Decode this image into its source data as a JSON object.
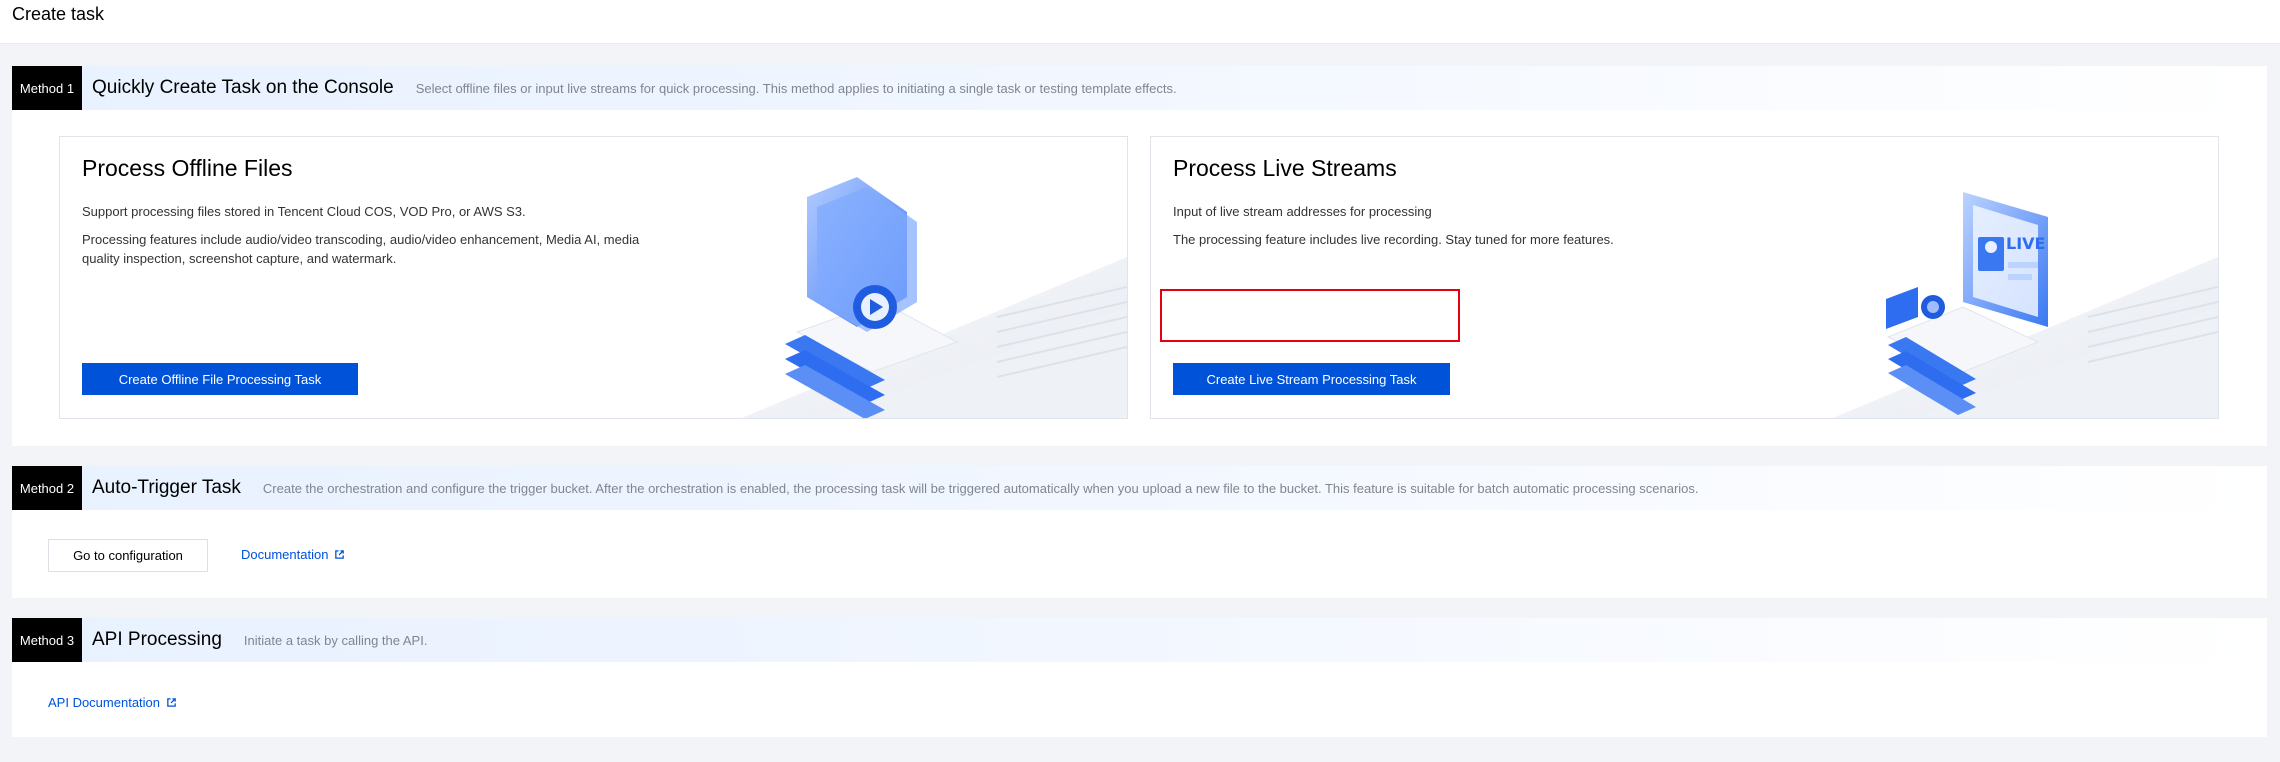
{
  "page": {
    "title": "Create task"
  },
  "method1": {
    "tag": "Method 1",
    "title": "Quickly Create Task on the Console",
    "description": "Select offline files or input live streams for quick processing. This method applies to initiating a single task or testing template effects.",
    "offline_card": {
      "title": "Process Offline Files",
      "line1": "Support processing files stored in Tencent Cloud COS, VOD Pro, or AWS S3.",
      "line2": "Processing features include audio/video transcoding, audio/video enhancement, Media AI, media quality inspection, screenshot capture, and watermark.",
      "button": "Create Offline File Processing Task",
      "illustration": "folder-play-icon"
    },
    "live_card": {
      "title": "Process Live Streams",
      "line1": "Input of live stream addresses for processing",
      "line2": "The processing feature includes live recording. Stay tuned for more features.",
      "button": "Create Live Stream Processing Task",
      "illustration": "live-camera-icon",
      "illustration_text": "LIVE"
    }
  },
  "method2": {
    "tag": "Method 2",
    "title": "Auto-Trigger Task",
    "description": "Create the orchestration and configure the trigger bucket. After the orchestration is enabled, the processing task will be triggered automatically when you upload a new file to the bucket. This feature is suitable for batch automatic processing scenarios.",
    "config_button": "Go to configuration",
    "doc_link": "Documentation"
  },
  "method3": {
    "tag": "Method 3",
    "title": "API Processing",
    "description": "Initiate a task by calling the API.",
    "doc_link": "API Documentation"
  },
  "colors": {
    "primary": "#0052d9",
    "highlight": "#e4000f",
    "tag_bg": "#000000"
  }
}
